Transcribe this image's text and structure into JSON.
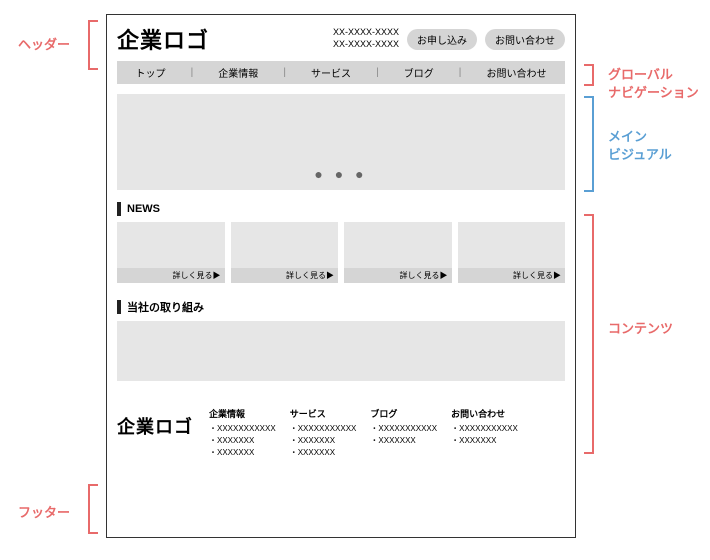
{
  "annotations": {
    "header": "ヘッダー",
    "gnav": "グローバル\nナビゲーション",
    "main_visual": "メイン\nビジュアル",
    "contents": "コンテンツ",
    "footer": "フッター"
  },
  "header": {
    "logo": "企業ロゴ",
    "phone1": "XX-XXXX-XXXX",
    "phone2": "XX-XXXX-XXXX",
    "apply_btn": "お申し込み",
    "contact_btn": "お問い合わせ"
  },
  "gnav": {
    "items": [
      "トップ",
      "企業情報",
      "サービス",
      "ブログ",
      "お問い合わせ"
    ],
    "sep": "|"
  },
  "main_visual": {
    "dots": "● ● ●"
  },
  "news": {
    "title": "NEWS",
    "more_label": "詳しく見る▶",
    "cards": [
      0,
      1,
      2,
      3
    ]
  },
  "initiatives": {
    "title": "当社の取り組み"
  },
  "footer": {
    "logo": "企業ロゴ",
    "cols": [
      {
        "title": "企業情報",
        "items": [
          "・XXXXXXXXXXX",
          "・XXXXXXX",
          "・XXXXXXX"
        ]
      },
      {
        "title": "サービス",
        "items": [
          "・XXXXXXXXXXX",
          "・XXXXXXX",
          "・XXXXXXX"
        ]
      },
      {
        "title": "ブログ",
        "items": [
          "・XXXXXXXXXXX",
          "・XXXXXXX"
        ]
      },
      {
        "title": "お問い合わせ",
        "items": [
          "・XXXXXXXXXXX",
          "・XXXXXXX"
        ]
      }
    ]
  }
}
